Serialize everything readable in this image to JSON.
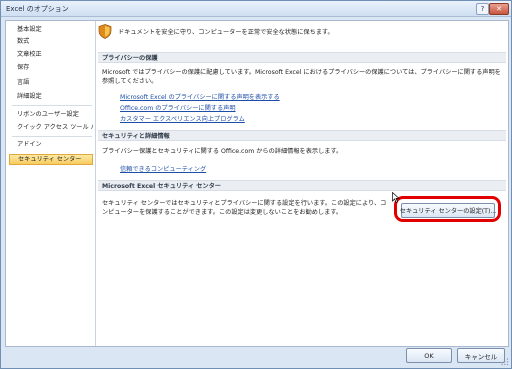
{
  "window": {
    "title": "Excel のオプション",
    "help_glyph": "?",
    "close_glyph": "✕"
  },
  "sidebar": {
    "items": [
      {
        "label": "基本設定"
      },
      {
        "label": "数式"
      },
      {
        "label": "文章校正"
      },
      {
        "label": "保存"
      },
      {
        "label": "言語"
      },
      {
        "label": "詳細設定"
      },
      {
        "label": "リボンのユーザー設定"
      },
      {
        "label": "クイック アクセス ツール バー"
      },
      {
        "label": "アドイン"
      },
      {
        "label": "セキュリティ センター"
      }
    ],
    "selected_index": 9
  },
  "main": {
    "intro_text": "ドキュメントを安全に守り、コンピューターを正常で安全な状態に保ちます。",
    "privacy": {
      "header": "プライバシーの保護",
      "text": "Microsoft ではプライバシーの保護に配慮しています。Microsoft Excel におけるプライバシーの保護については、プライバシーに関する声明を参照してください。",
      "links": [
        "Microsoft Excel のプライバシーに関する声明を表示する",
        "Office.com のプライバシーに関する声明",
        "カスタマー エクスペリエンス向上プログラム"
      ]
    },
    "security_detail": {
      "header": "セキュリティと詳細情報",
      "text": "プライバシー保護とセキュリティに関する Office.com からの詳細情報を表示します。",
      "link": "信頼できるコンピューティング"
    },
    "trust_center": {
      "header": "Microsoft Excel セキュリティ センター",
      "text": "セキュリティ センターではセキュリティとプライバシーに関する設定を行います。この設定により、コンピューターを保護することができます。この設定は変更しないことをお勧めします。",
      "button_label": "セキュリティ センターの設定(T)..."
    }
  },
  "footer": {
    "ok_label": "OK",
    "cancel_label": "キャンセル"
  },
  "colors": {
    "highlight_ring": "#e00000",
    "selected_nav": "#f8cb5e",
    "link": "#1d4ea8"
  }
}
